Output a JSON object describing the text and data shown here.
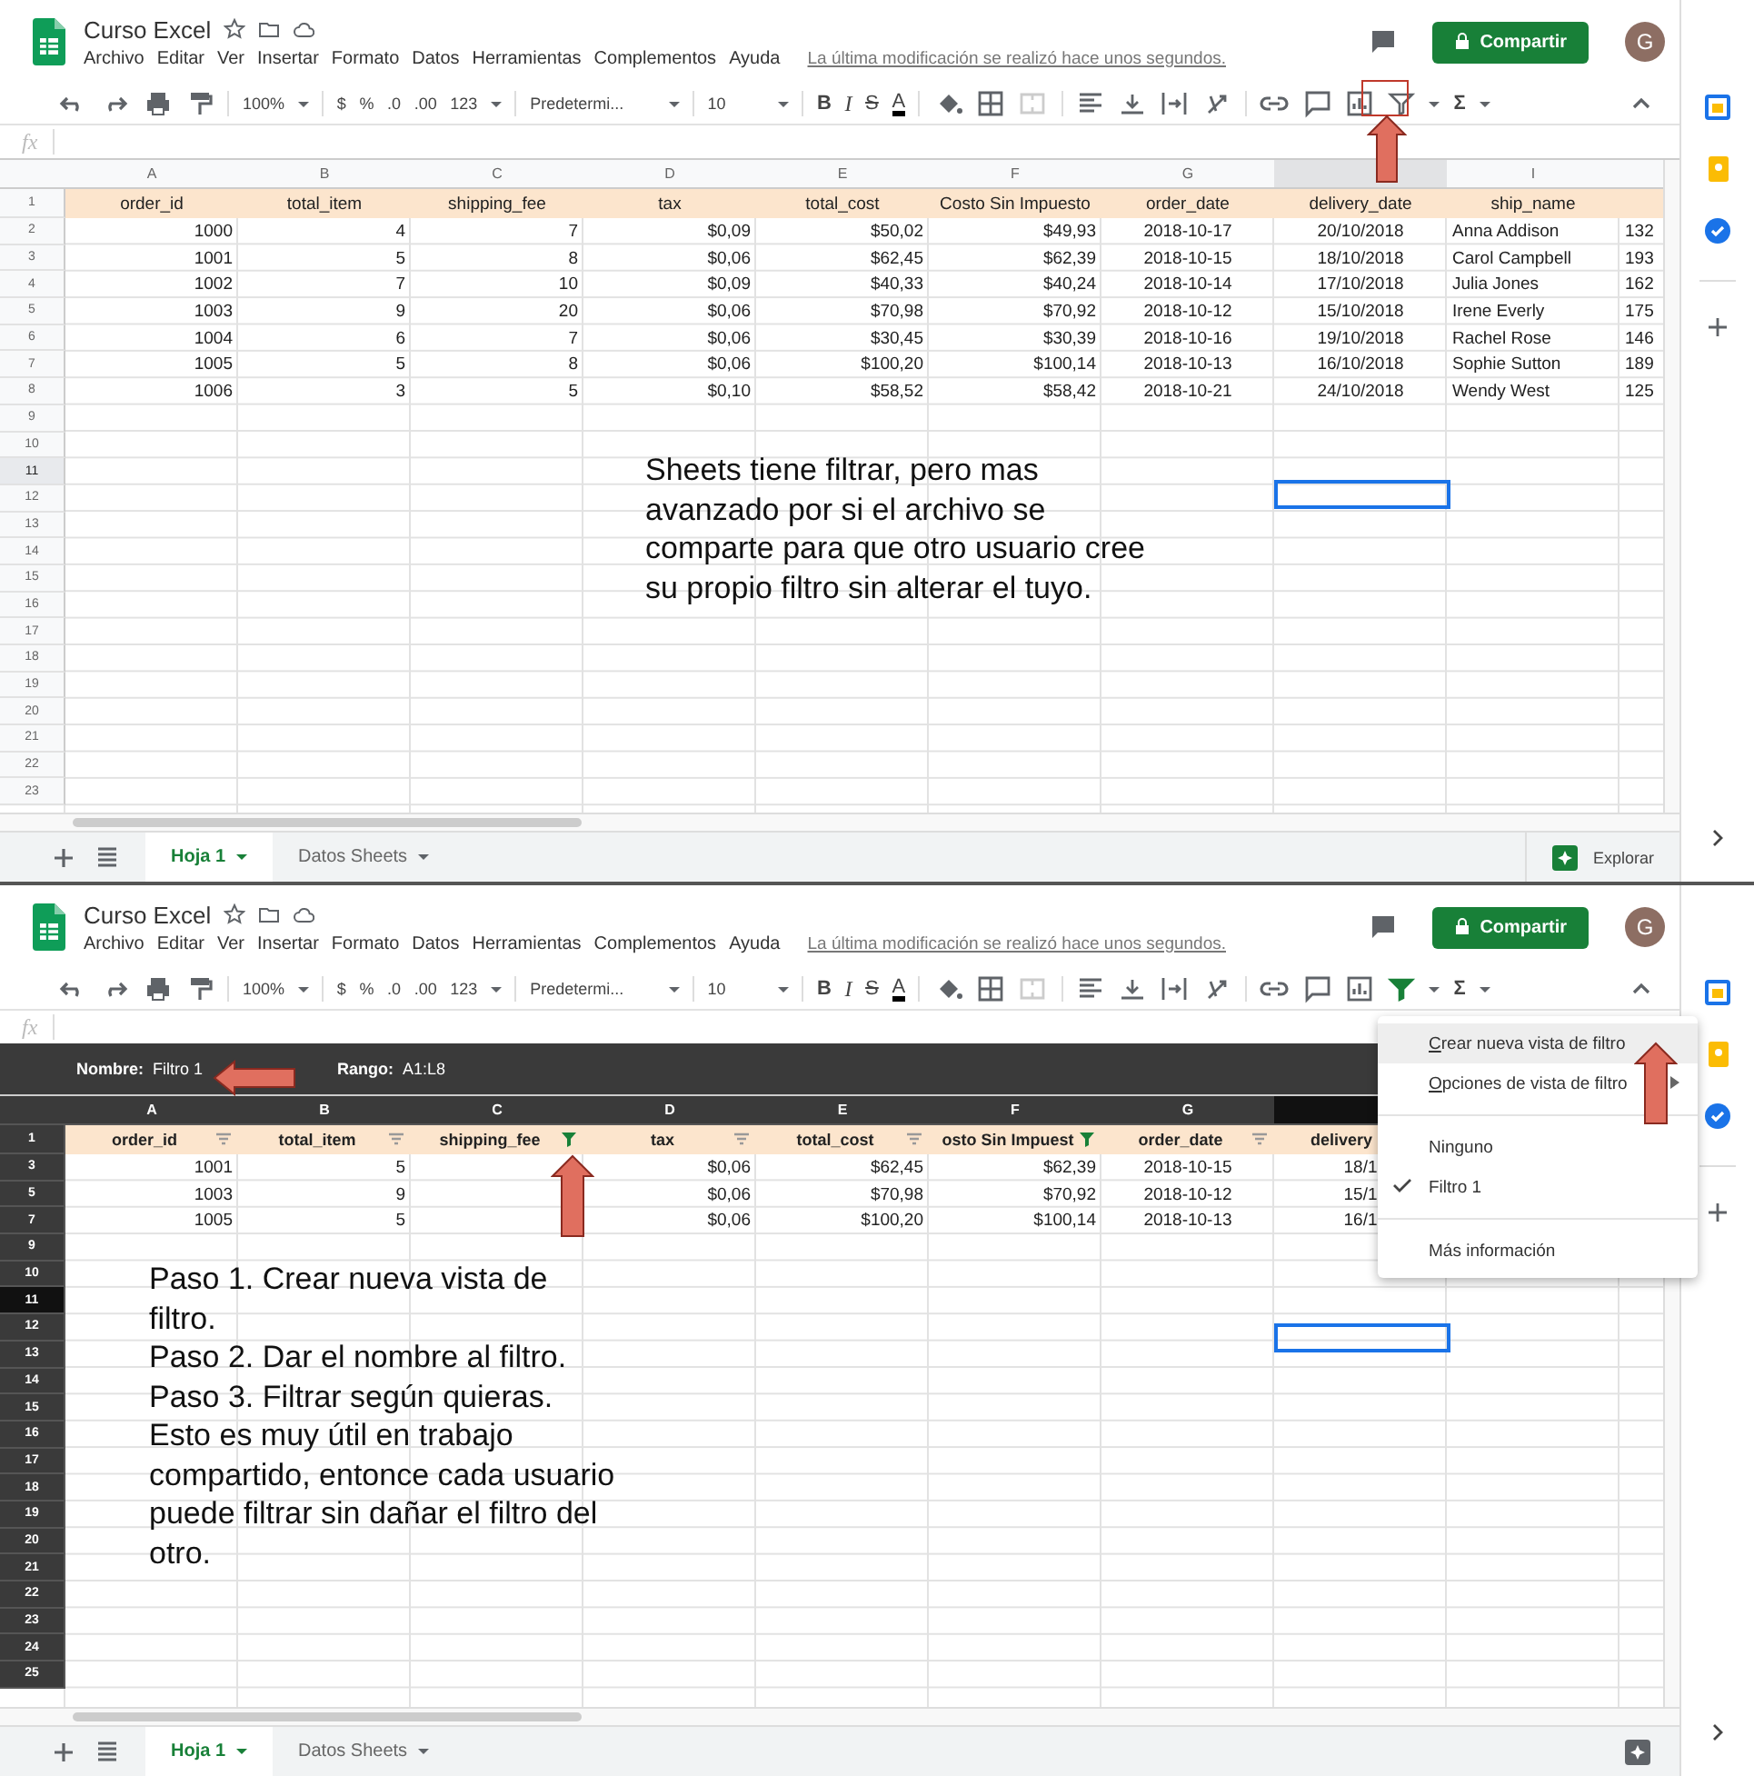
{
  "panes": [
    {
      "title": "Curso Excel",
      "menu": [
        "Archivo",
        "Editar",
        "Ver",
        "Insertar",
        "Formato",
        "Datos",
        "Herramientas",
        "Complementos",
        "Ayuda"
      ],
      "last_edit": "La última modificación se realizó hace unos segundos.",
      "share_label": "Compartir",
      "avatar": "G",
      "toolbar": {
        "zoom": "100%",
        "currency": "$",
        "percent": "%",
        "decimal_less": ".0",
        "decimal_more": ".00",
        "number_format": "123",
        "font": "Predetermi...",
        "font_size": "10",
        "bold": "B",
        "italic": "I",
        "strike": "S",
        "text_color": "A",
        "functions": "Σ",
        "filter_active": false
      },
      "formula_label": "fx",
      "columns": [
        {
          "label": "A",
          "selected": false
        },
        {
          "label": "B",
          "selected": false
        },
        {
          "label": "C",
          "selected": false
        },
        {
          "label": "D",
          "selected": false
        },
        {
          "label": "E",
          "selected": false
        },
        {
          "label": "F",
          "selected": false
        },
        {
          "label": "G",
          "selected": false
        },
        {
          "selected": true
        },
        {
          "label": "I",
          "selected": false
        }
      ],
      "rows": [
        {
          "num": "1",
          "kind": "header",
          "selected": false,
          "cells": [
            {
              "text": "order_id"
            },
            {
              "text": "total_item"
            },
            {
              "text": "shipping_fee"
            },
            {
              "text": "tax"
            },
            {
              "text": "total_cost"
            },
            {
              "text": "Costo Sin Impuesto"
            },
            {
              "text": "order_date"
            },
            {
              "text": "delivery_date"
            },
            {
              "text": "ship_name"
            }
          ]
        },
        {
          "num": "2",
          "kind": "data",
          "selected": false,
          "cells": [
            "1000",
            "4",
            "7",
            "$0,09",
            "$50,02",
            "$49,93",
            "2018-10-17",
            "20/10/2018",
            "Anna Addison",
            "132"
          ]
        },
        {
          "num": "3",
          "kind": "data",
          "selected": false,
          "cells": [
            "1001",
            "5",
            "8",
            "$0,06",
            "$62,45",
            "$62,39",
            "2018-10-15",
            "18/10/2018",
            "Carol Campbell",
            "193"
          ]
        },
        {
          "num": "4",
          "kind": "data",
          "selected": false,
          "cells": [
            "1002",
            "7",
            "10",
            "$0,09",
            "$40,33",
            "$40,24",
            "2018-10-14",
            "17/10/2018",
            "Julia Jones",
            "162"
          ]
        },
        {
          "num": "5",
          "kind": "data",
          "selected": false,
          "cells": [
            "1003",
            "9",
            "20",
            "$0,06",
            "$70,98",
            "$70,92",
            "2018-10-12",
            "15/10/2018",
            "Irene Everly",
            "175"
          ]
        },
        {
          "num": "6",
          "kind": "data",
          "selected": false,
          "cells": [
            "1004",
            "6",
            "7",
            "$0,06",
            "$30,45",
            "$30,39",
            "2018-10-16",
            "19/10/2018",
            "Rachel Rose",
            "146"
          ]
        },
        {
          "num": "7",
          "kind": "data",
          "selected": false,
          "cells": [
            "1005",
            "5",
            "8",
            "$0,06",
            "$100,20",
            "$100,14",
            "2018-10-13",
            "16/10/2018",
            "Sophie Sutton",
            "189"
          ]
        },
        {
          "num": "8",
          "kind": "data",
          "selected": false,
          "cells": [
            "1006",
            "3",
            "5",
            "$0,10",
            "$58,52",
            "$58,42",
            "2018-10-21",
            "24/10/2018",
            "Wendy West",
            "125"
          ]
        },
        {
          "num": "9",
          "kind": "empty",
          "selected": false
        },
        {
          "num": "10",
          "kind": "empty",
          "selected": false
        },
        {
          "num": "11",
          "kind": "empty",
          "selected": true
        },
        {
          "num": "12",
          "kind": "empty",
          "selected": false
        },
        {
          "num": "13",
          "kind": "empty",
          "selected": false
        },
        {
          "num": "14",
          "kind": "empty",
          "selected": false
        },
        {
          "num": "15",
          "kind": "empty",
          "selected": false
        },
        {
          "num": "16",
          "kind": "empty",
          "selected": false
        },
        {
          "num": "17",
          "kind": "empty",
          "selected": false
        },
        {
          "num": "18",
          "kind": "empty",
          "selected": false
        },
        {
          "num": "19",
          "kind": "empty",
          "selected": false
        },
        {
          "num": "20",
          "kind": "empty",
          "selected": false
        },
        {
          "num": "21",
          "kind": "empty",
          "selected": false
        },
        {
          "num": "22",
          "kind": "empty",
          "selected": false
        },
        {
          "num": "23",
          "kind": "empty",
          "selected": false
        }
      ],
      "note": [
        "Sheets tiene filtrar, pero mas avanzado por si el archivo se comparte para que otro usuario cree su propio filtro sin alterar el tuyo."
      ],
      "tabs": [
        {
          "label": "Hoja 1",
          "selected": true
        },
        {
          "label": "Datos Sheets",
          "selected": false
        }
      ],
      "explore_label": "Explorar",
      "annotations": [
        {
          "kind": "filter-button-box"
        },
        {
          "kind": "filter-button-arrow"
        }
      ]
    },
    {
      "title": "Curso Excel",
      "menu": [
        "Archivo",
        "Editar",
        "Ver",
        "Insertar",
        "Formato",
        "Datos",
        "Herramientas",
        "Complementos",
        "Ayuda"
      ],
      "last_edit": "La última modificación se realizó hace unos segundos.",
      "share_label": "Compartir",
      "avatar": "G",
      "toolbar": {
        "zoom": "100%",
        "currency": "$",
        "percent": "%",
        "decimal_less": ".0",
        "decimal_more": ".00",
        "number_format": "123",
        "font": "Predetermi...",
        "font_size": "10",
        "bold": "B",
        "italic": "I",
        "strike": "S",
        "text_color": "A",
        "functions": "Σ",
        "filter_active": true
      },
      "formula_label": "fx",
      "filter_view": {
        "name_label": "Nombre:",
        "name": "Filtro 1",
        "range_label": "Rango:",
        "range": "A1:L8"
      },
      "columns": [
        {
          "label": "A",
          "selected": false
        },
        {
          "label": "B",
          "selected": false
        },
        {
          "label": "C",
          "selected": false
        },
        {
          "label": "D",
          "selected": false
        },
        {
          "label": "E",
          "selected": false
        },
        {
          "label": "F",
          "selected": false
        },
        {
          "label": "G",
          "selected": false
        },
        {
          "selected": true
        }
      ],
      "rows": [
        {
          "num": "1",
          "kind": "header",
          "selected": false,
          "cells": [
            {
              "text": "order_id",
              "filter_active": false
            },
            {
              "text": "total_item",
              "filter_active": false
            },
            {
              "text": "shipping_fee",
              "filter_active": true
            },
            {
              "text": "tax",
              "filter_active": false
            },
            {
              "text": "total_cost",
              "filter_active": false
            },
            {
              "text": "osto Sin Impuest",
              "filter_active": true
            },
            {
              "text": "order_date",
              "filter_active": false
            },
            {
              "text": "delivery"
            }
          ]
        },
        {
          "num": "3",
          "kind": "data",
          "selected": false,
          "cells": [
            "1001",
            "5",
            "",
            "$0,06",
            "$62,45",
            "$62,39",
            "2018-10-15",
            "18/1"
          ]
        },
        {
          "num": "5",
          "kind": "data",
          "selected": false,
          "cells": [
            "1003",
            "9",
            "",
            "$0,06",
            "$70,98",
            "$70,92",
            "2018-10-12",
            "15/1"
          ]
        },
        {
          "num": "7",
          "kind": "data",
          "selected": false,
          "cells": [
            "1005",
            "5",
            "",
            "$0,06",
            "$100,20",
            "$100,14",
            "2018-10-13",
            "16/1"
          ]
        },
        {
          "num": "9",
          "kind": "empty",
          "selected": false
        },
        {
          "num": "10",
          "kind": "empty",
          "selected": false
        },
        {
          "num": "11",
          "kind": "empty",
          "selected": true
        },
        {
          "num": "12",
          "kind": "empty",
          "selected": false
        },
        {
          "num": "13",
          "kind": "empty",
          "selected": false
        },
        {
          "num": "14",
          "kind": "empty",
          "selected": false
        },
        {
          "num": "15",
          "kind": "empty",
          "selected": false
        },
        {
          "num": "16",
          "kind": "empty",
          "selected": false
        },
        {
          "num": "17",
          "kind": "empty",
          "selected": false
        },
        {
          "num": "18",
          "kind": "empty",
          "selected": false
        },
        {
          "num": "19",
          "kind": "empty",
          "selected": false
        },
        {
          "num": "20",
          "kind": "empty",
          "selected": false
        },
        {
          "num": "21",
          "kind": "empty",
          "selected": false
        },
        {
          "num": "22",
          "kind": "empty",
          "selected": false
        },
        {
          "num": "23",
          "kind": "empty",
          "selected": false
        },
        {
          "num": "24",
          "kind": "empty",
          "selected": false
        },
        {
          "num": "25",
          "kind": "empty",
          "selected": false
        }
      ],
      "note": [
        "Paso 1. Crear nueva vista de filtro.",
        "Paso 2. Dar el nombre al filtro.",
        "Paso 3. Filtrar según quieras.",
        "Esto es muy útil en trabajo compartido, entonce cada usuario puede filtrar sin dañar el filtro del otro."
      ],
      "filter_menu": [
        {
          "kind": "action",
          "label": "Crear nueva vista de filtro",
          "highlighted": true,
          "accel": true
        },
        {
          "kind": "submenu",
          "label": "Opciones de vista de filtro",
          "highlighted": false,
          "accel": true
        },
        {
          "kind": "divider"
        },
        {
          "kind": "option",
          "label": "Ninguno",
          "checked": false
        },
        {
          "kind": "option",
          "label": "Filtro 1",
          "checked": true
        },
        {
          "kind": "divider"
        },
        {
          "kind": "action",
          "label": "Más información",
          "highlighted": false,
          "accel": false
        }
      ],
      "tabs": [
        {
          "label": "Hoja 1",
          "selected": true
        },
        {
          "label": "Datos Sheets",
          "selected": false
        }
      ],
      "annotations": [
        {
          "kind": "filter-name-arrow"
        },
        {
          "kind": "filter-column-arrow"
        },
        {
          "kind": "menu-arrow"
        }
      ]
    }
  ]
}
